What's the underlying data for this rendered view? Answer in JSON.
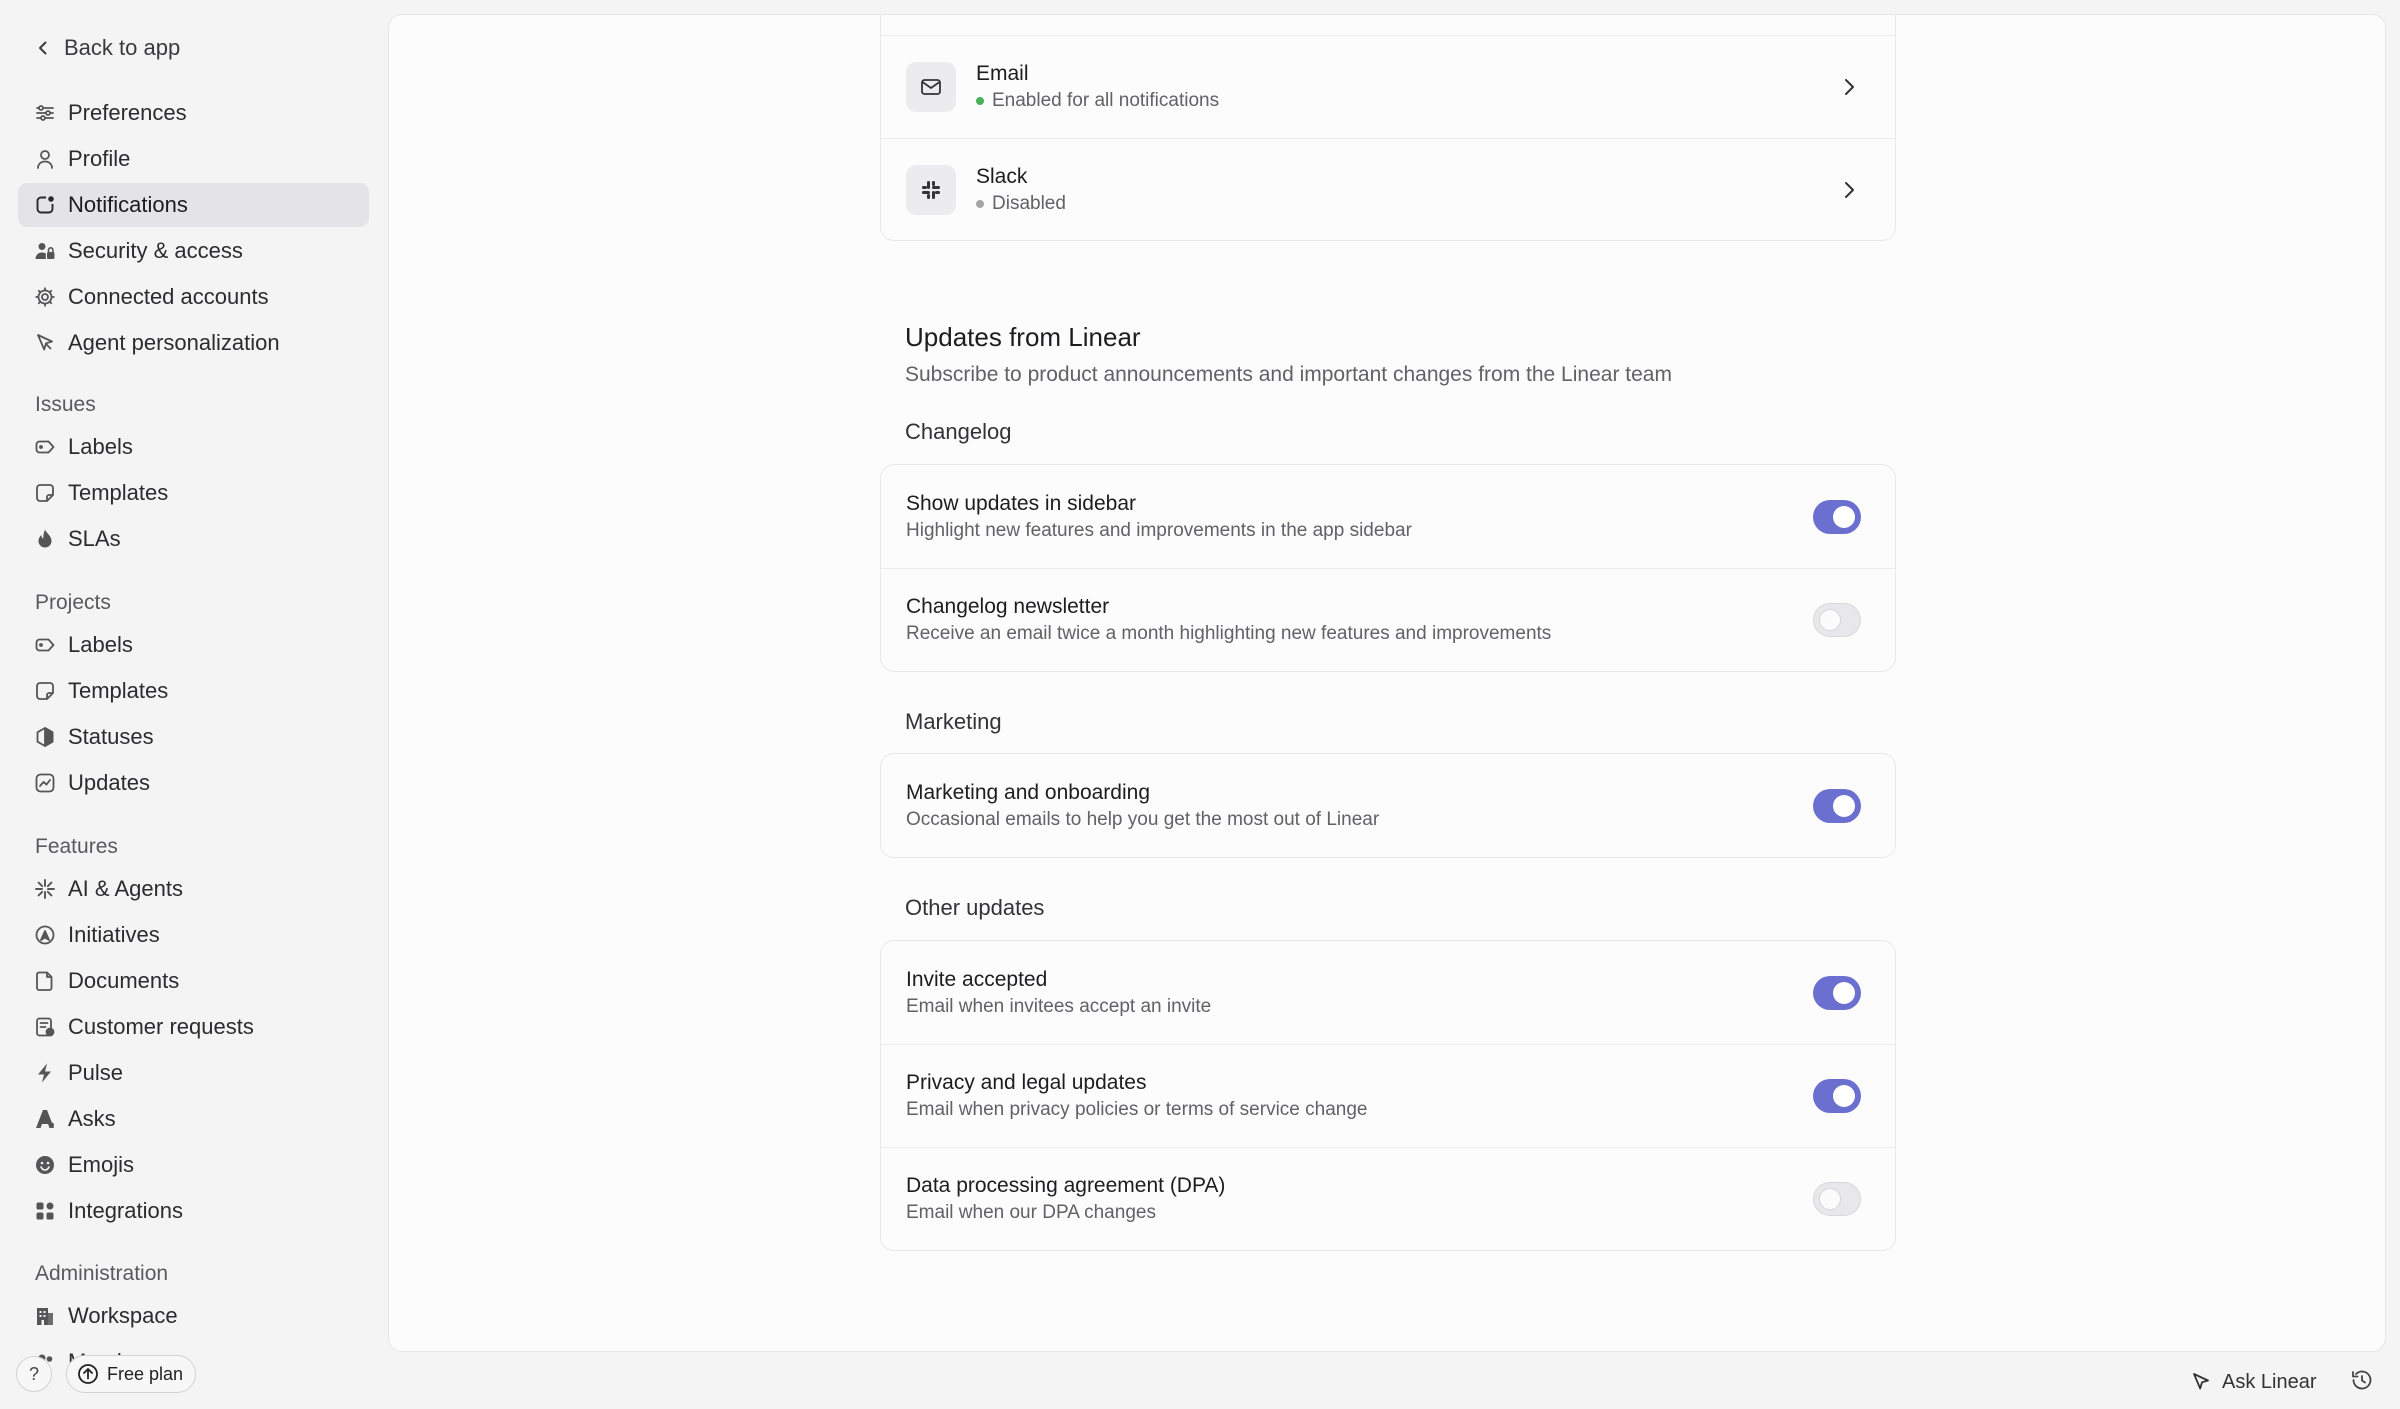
{
  "sidebar": {
    "back_label": "Back to app",
    "account_items": [
      {
        "label": "Preferences",
        "icon": "sliders-icon"
      },
      {
        "label": "Profile",
        "icon": "person-icon"
      },
      {
        "label": "Notifications",
        "icon": "notification-icon",
        "active": true
      },
      {
        "label": "Security & access",
        "icon": "security-icon"
      },
      {
        "label": "Connected accounts",
        "icon": "gear-icon"
      },
      {
        "label": "Agent personalization",
        "icon": "agent-icon"
      }
    ],
    "issues": {
      "heading": "Issues",
      "items": [
        {
          "label": "Labels",
          "icon": "label-icon"
        },
        {
          "label": "Templates",
          "icon": "template-icon"
        },
        {
          "label": "SLAs",
          "icon": "flame-icon"
        }
      ]
    },
    "projects": {
      "heading": "Projects",
      "items": [
        {
          "label": "Labels",
          "icon": "label-icon"
        },
        {
          "label": "Templates",
          "icon": "template-icon"
        },
        {
          "label": "Statuses",
          "icon": "hexagon-icon"
        },
        {
          "label": "Updates",
          "icon": "chart-icon"
        }
      ]
    },
    "features": {
      "heading": "Features",
      "items": [
        {
          "label": "AI & Agents",
          "icon": "sparkle-icon"
        },
        {
          "label": "Initiatives",
          "icon": "initiative-icon"
        },
        {
          "label": "Documents",
          "icon": "document-icon"
        },
        {
          "label": "Customer requests",
          "icon": "request-icon"
        },
        {
          "label": "Pulse",
          "icon": "pulse-icon"
        },
        {
          "label": "Asks",
          "icon": "asks-icon"
        },
        {
          "label": "Emojis",
          "icon": "emoji-icon"
        },
        {
          "label": "Integrations",
          "icon": "grid-icon"
        }
      ]
    },
    "administration": {
      "heading": "Administration",
      "items": [
        {
          "label": "Workspace",
          "icon": "building-icon"
        },
        {
          "label": "Members",
          "icon": "members-icon"
        }
      ]
    },
    "help_label": "?",
    "plan_label": "Free plan"
  },
  "channels": [
    {
      "name": "Email",
      "status": "Enabled for all notifications",
      "status_color": "#4cb05a",
      "icon": "mail-icon"
    },
    {
      "name": "Slack",
      "status": "Disabled",
      "status_color": "#a5a5a9",
      "icon": "slack-icon"
    }
  ],
  "updates": {
    "title": "Updates from Linear",
    "subtitle": "Subscribe to product announcements and important changes from the Linear team",
    "groups": [
      {
        "heading": "Changelog",
        "rows": [
          {
            "title": "Show updates in sidebar",
            "desc": "Highlight new features and improvements in the app sidebar",
            "on": true
          },
          {
            "title": "Changelog newsletter",
            "desc": "Receive an email twice a month highlighting new features and improvements",
            "on": false
          }
        ]
      },
      {
        "heading": "Marketing",
        "rows": [
          {
            "title": "Marketing and onboarding",
            "desc": "Occasional emails to help you get the most out of Linear",
            "on": true
          }
        ]
      },
      {
        "heading": "Other updates",
        "rows": [
          {
            "title": "Invite accepted",
            "desc": "Email when invitees accept an invite",
            "on": true
          },
          {
            "title": "Privacy and legal updates",
            "desc": "Email when privacy policies or terms of service change",
            "on": true
          },
          {
            "title": "Data processing agreement (DPA)",
            "desc": "Email when our DPA changes",
            "on": false
          }
        ]
      }
    ]
  },
  "footer": {
    "ask_label": "Ask Linear"
  },
  "colors": {
    "accent": "#6b6fd0",
    "active_bg": "#e4e4e6",
    "enabled_dot": "#4cb05a",
    "disabled_dot": "#a5a5a9"
  }
}
